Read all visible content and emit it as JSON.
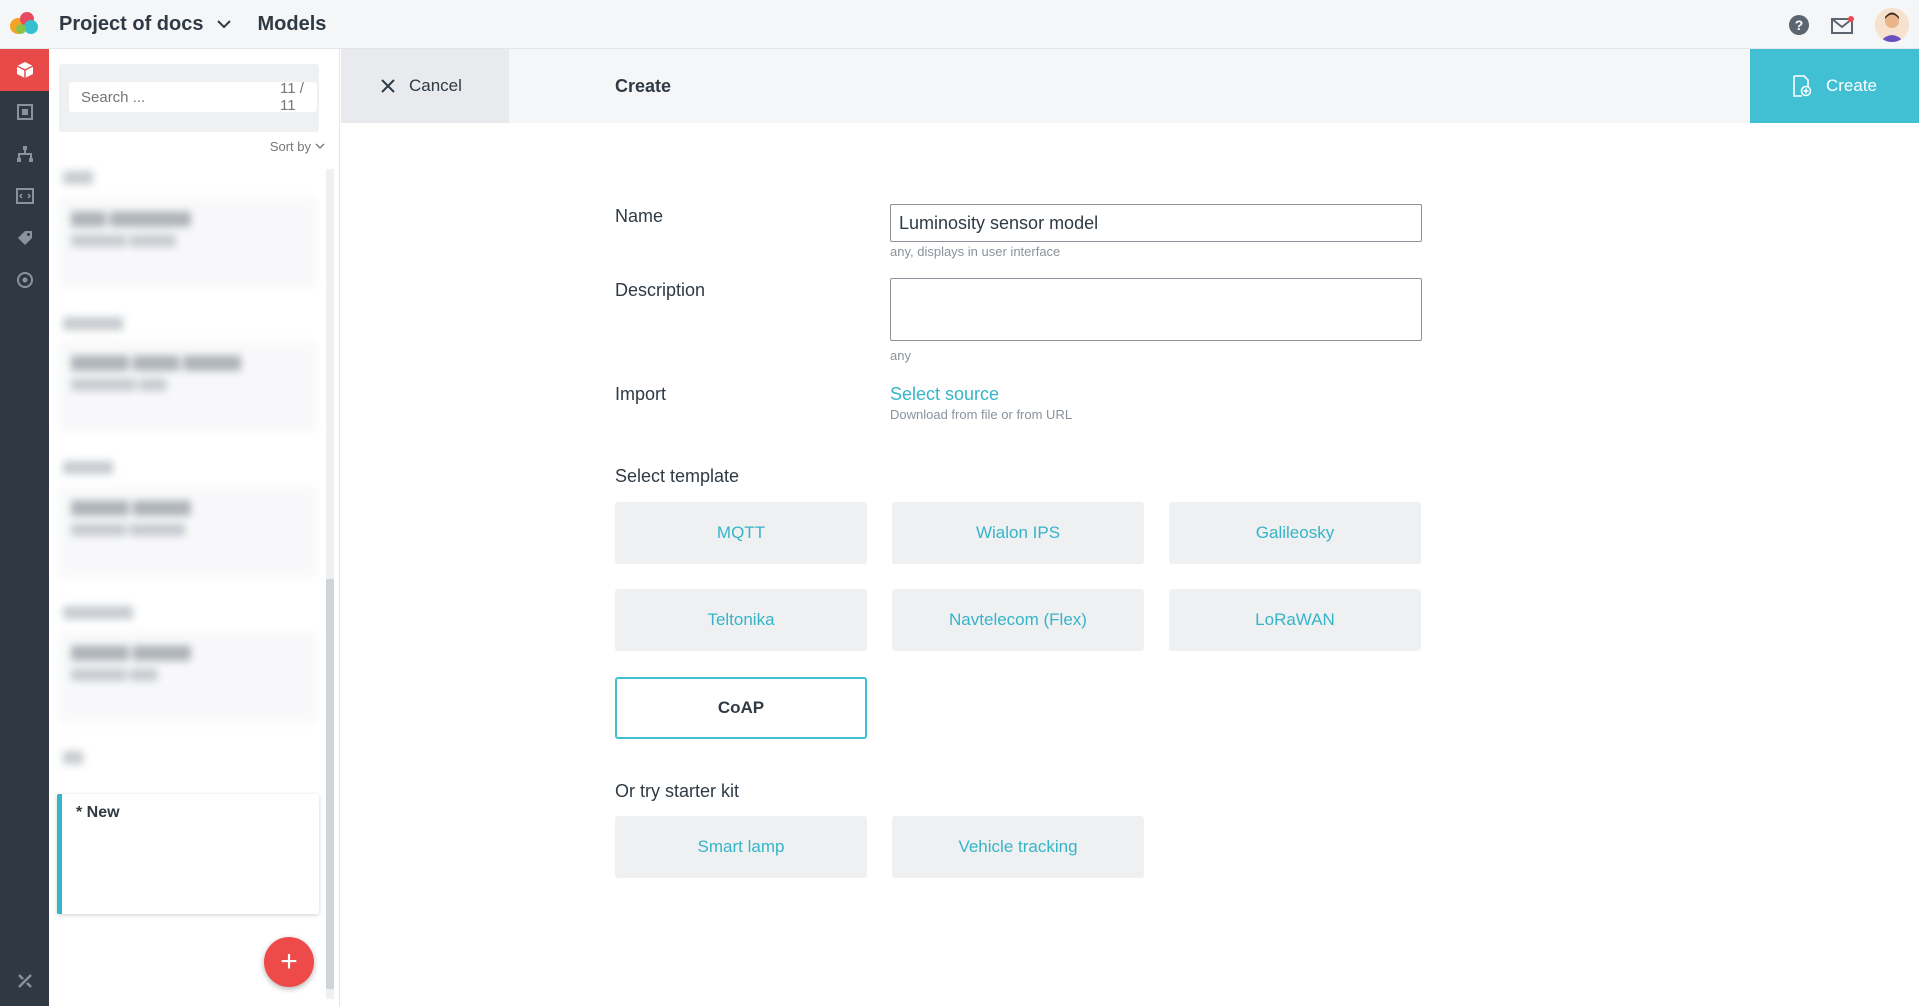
{
  "header": {
    "project_title": "Project of docs",
    "section_title": "Models"
  },
  "list": {
    "search_placeholder": "Search ...",
    "search_count": "11 / 11",
    "sort_label": "Sort by",
    "new_item_label": "* New",
    "add_symbol": "+"
  },
  "actionbar": {
    "cancel_label": "Cancel",
    "heading": "Create",
    "create_label": "Create"
  },
  "form": {
    "name_label": "Name",
    "name_value": "Luminosity sensor model",
    "name_hint": "any, displays in user interface",
    "description_label": "Description",
    "description_value": "",
    "description_hint": "any",
    "import_label": "Import",
    "import_link": "Select source",
    "import_hint": "Download from file or from URL",
    "template_label": "Select template",
    "templates": [
      "MQTT",
      "Wialon IPS",
      "Galileosky",
      "Teltonika",
      "Navtelecom (Flex)",
      "LoRaWAN",
      "CoAP"
    ],
    "selected_template": "CoAP",
    "starter_label": "Or try starter kit",
    "starter_kits": [
      "Smart lamp",
      "Vehicle tracking"
    ]
  },
  "colors": {
    "accent": "#41bfd3",
    "rail_bg": "#2f3843",
    "rail_active": "#e84a4a",
    "fab": "#ef4a4a"
  },
  "icons": {
    "rail": [
      "models-cube-icon",
      "devices-icon",
      "hierarchy-icon",
      "code-icon",
      "tag-icon",
      "settings-globe-icon"
    ],
    "rail_bottom": "tools-icon"
  }
}
